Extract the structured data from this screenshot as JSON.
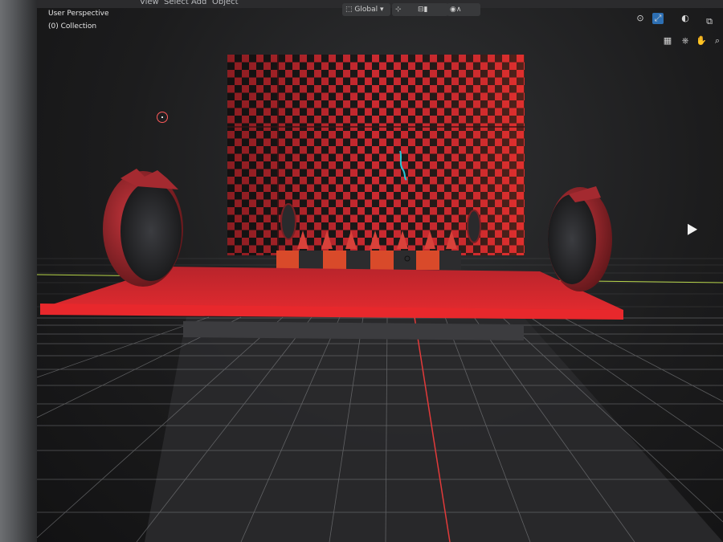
{
  "viewport": {
    "perspective_label": "User Perspective",
    "collection_label": "(0) Collection"
  },
  "header": {
    "menu": [
      "View",
      "Select",
      "Add",
      "Object"
    ],
    "transform_orientation": "Global"
  },
  "icons": {
    "pivot": "pivot-icon",
    "snap": "snap-icon",
    "proportional": "proportional-editing-icon",
    "gizmo": "gizmo-icon",
    "overlay": "overlay-icon",
    "grid_view": "grid-view-icon",
    "camera": "camera-icon",
    "hand": "hand-icon",
    "zoom": "zoom-icon"
  },
  "colors": {
    "accent_red": "#e0262b",
    "x_axis": "#e23a3a",
    "y_axis": "#b8d64a",
    "grid": "#8a8b8e"
  }
}
